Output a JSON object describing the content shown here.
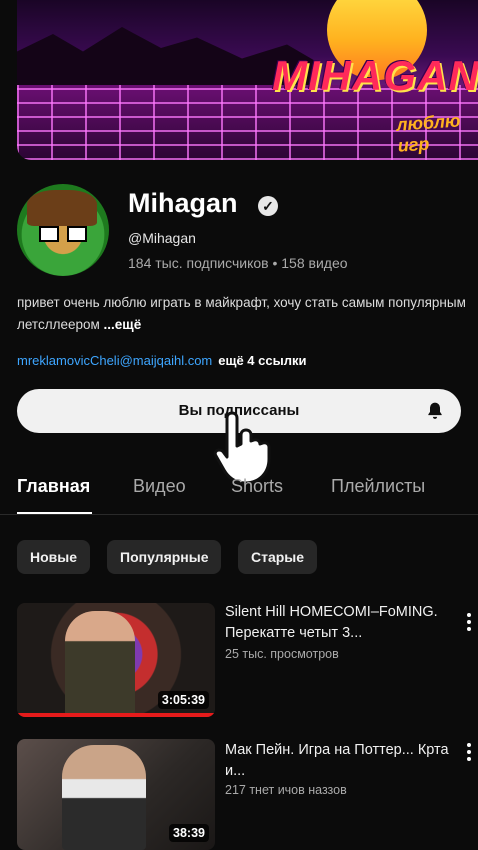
{
  "banner": {
    "brand": "MIHAGAN",
    "tagline": "люблю игр"
  },
  "channel": {
    "name": "Mihagan",
    "handle": "@Mihagan",
    "stats": "184 тыс. подписчиков • 158 видео",
    "description": "привет очень люблю играть в майкрафт, хочу стать самым популярным летсллеером",
    "more": " ...ещё",
    "link": "mreklamovicCheli@maijqaihl.com",
    "more_links": "ещё 4 ссылки"
  },
  "subscribe": {
    "label": "Вы подписсаны"
  },
  "tabs": [
    "Главная",
    "Видео",
    "Shorts",
    "Плейлисты"
  ],
  "chips": [
    "Новые",
    "Популярные",
    "Старые"
  ],
  "videos": [
    {
      "title": "Silent Hill HOMECOMI–FoMING. Перекатте четыт 3...",
      "meta": "25 тыс. просмотров",
      "duration": "3:05:39"
    },
    {
      "title": "Мак Пейн. Игра на Поттер... Крта и...",
      "meta": "217 тнет ичов наззов",
      "duration": "38:39"
    }
  ]
}
